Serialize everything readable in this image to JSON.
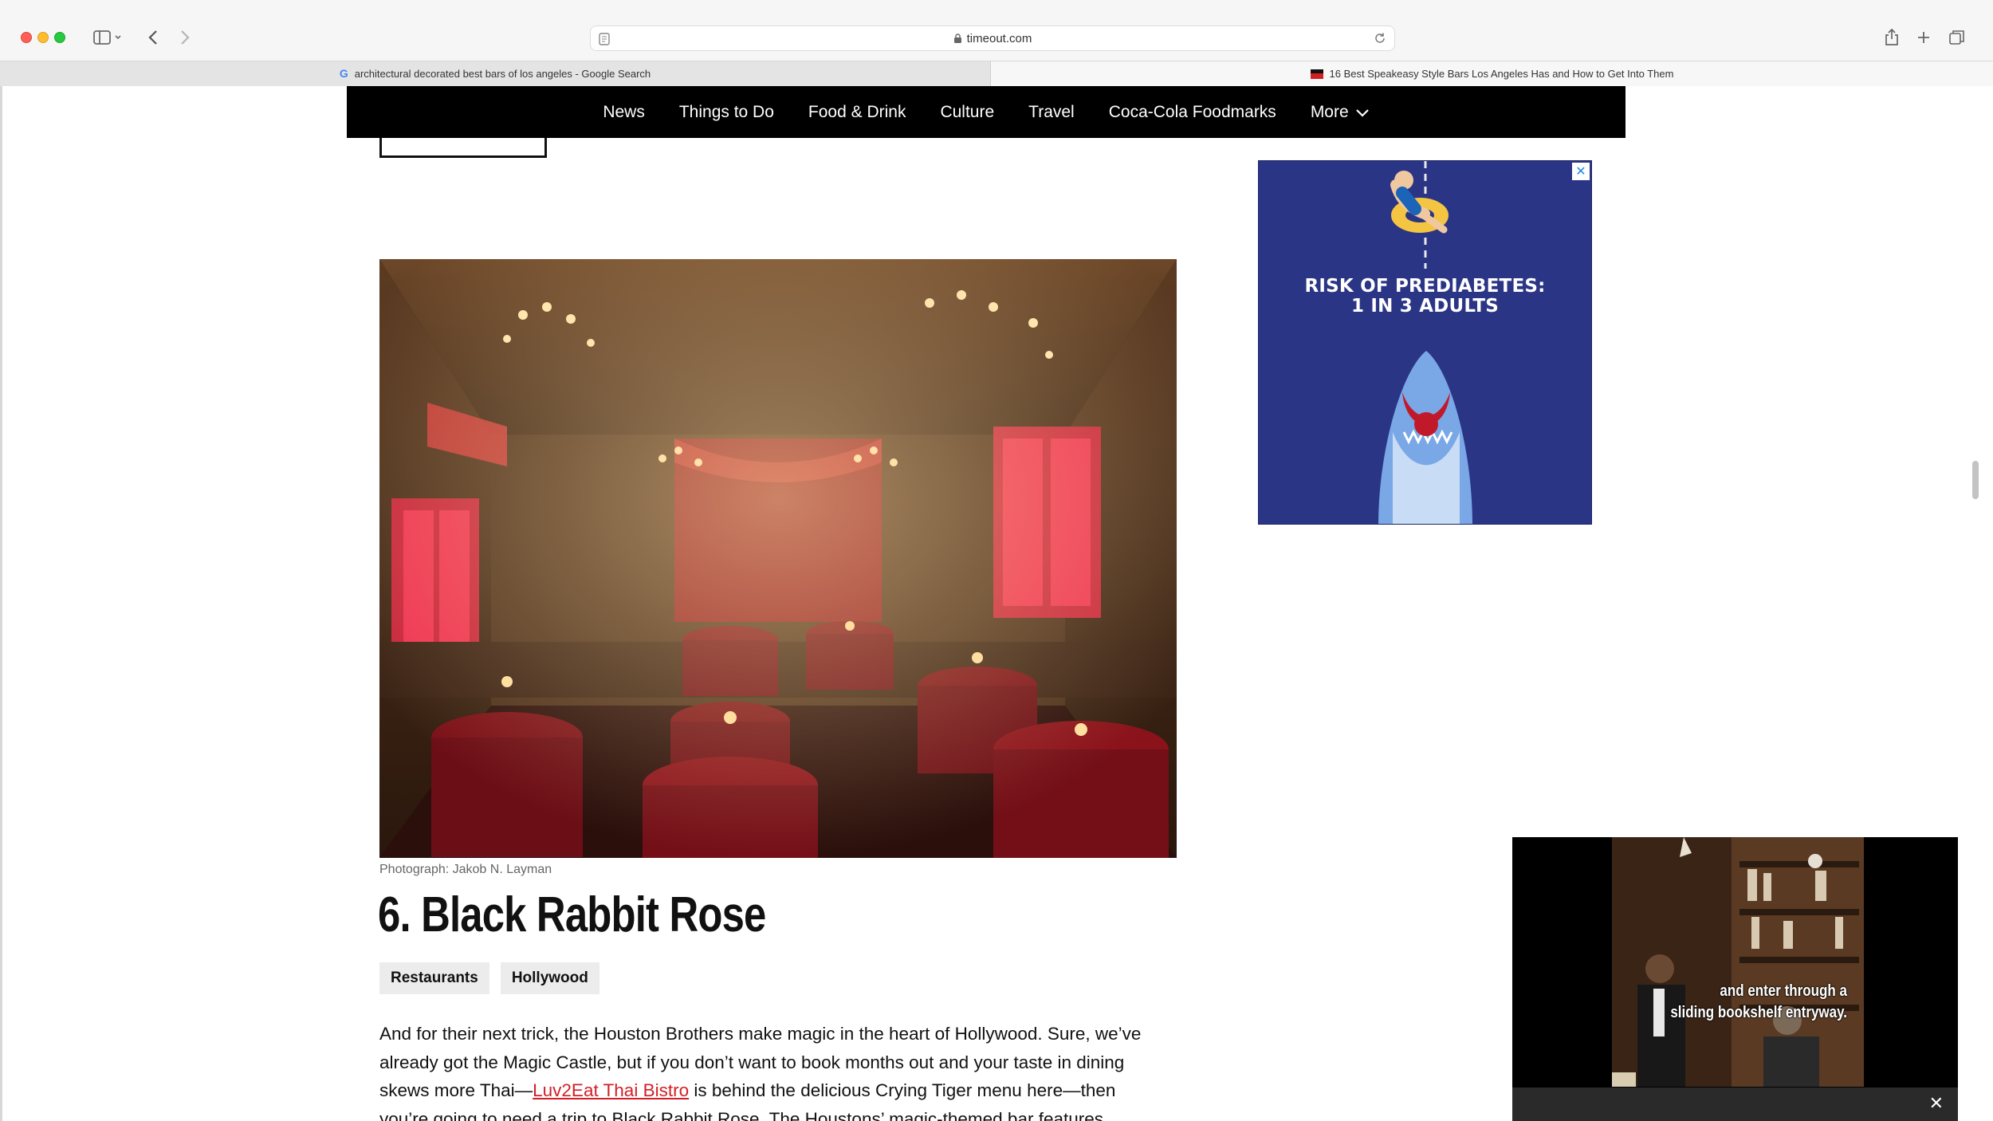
{
  "browser": {
    "url_host": "timeout.com",
    "tabs": [
      {
        "label": "architectural decorated best bars of los angeles - Google Search"
      },
      {
        "label": "16 Best Speakeasy Style Bars Los Angeles Has and How to Get Into Them"
      }
    ]
  },
  "nav": {
    "items": [
      "News",
      "Things to Do",
      "Food & Drink",
      "Culture",
      "Travel",
      "Coca-Cola Foodmarks"
    ],
    "more_label": "More"
  },
  "ad": {
    "headline_1": "RISK OF PREDIABETES:",
    "headline_2": "1 IN 3 ADULTS",
    "close_label": "✕"
  },
  "article": {
    "photo_caption": "Photograph: Jakob N. Layman",
    "title": "6. Black Rabbit Rose",
    "tags": [
      "Restaurants",
      "Hollywood"
    ],
    "body_1": "And for their next trick, the Houston Brothers make magic in the heart of Hollywood. Sure, we’ve already got the Magic Castle, but if you don’t want to book months out and your taste in dining skews more Thai—",
    "body_link": "Luv2Eat Thai Bistro",
    "body_2": " is behind the delicious Crying Tiger menu here—then you’re going to need a trip to Black Rabbit Rose. The Houstons’ magic-themed bar features"
  },
  "video": {
    "subtitle_1": "and enter through a",
    "subtitle_2": "sliding bookshelf entryway.",
    "close_label": "✕"
  },
  "colors": {
    "nav_bg": "#000000",
    "ad_bg": "#2b3585",
    "link": "#d21f26"
  }
}
